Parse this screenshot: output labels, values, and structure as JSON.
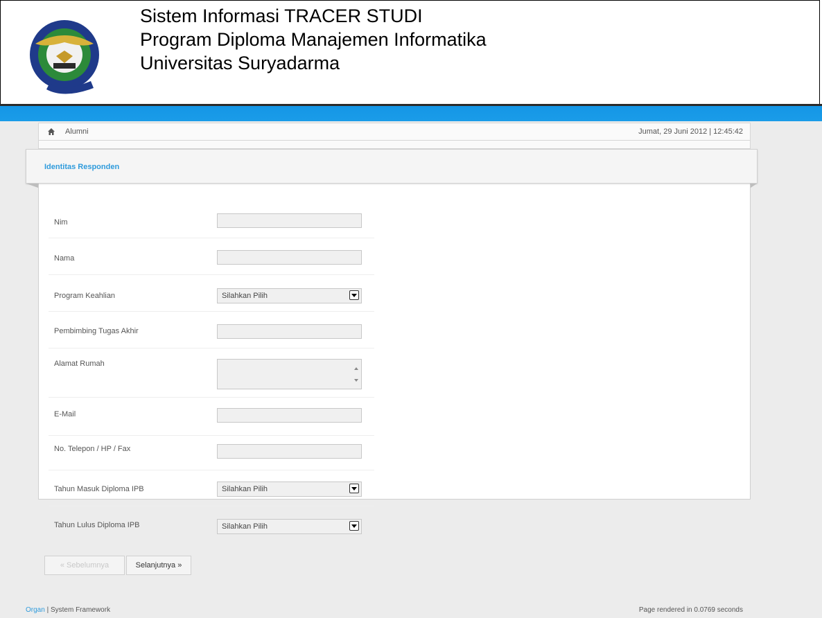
{
  "header": {
    "line1": "Sistem Informasi TRACER STUDI",
    "line2": "Program Diploma Manajemen Informatika",
    "line3": "Universitas Suryadarma"
  },
  "breadcrumb": {
    "home_icon": "home-icon",
    "current": "Alumni",
    "datetime": "Jumat, 29 Juni 2012 | 12:45:42"
  },
  "panel": {
    "title": "Identitas Responden"
  },
  "form": {
    "fields": [
      {
        "label": "Nim"
      },
      {
        "label": "Nama"
      },
      {
        "label": "Program Keahlian",
        "selected": "Silahkan Pilih"
      },
      {
        "label": "Pembimbing Tugas Akhir"
      },
      {
        "label": "Alamat Rumah"
      },
      {
        "label": "E-Mail"
      },
      {
        "label": "No. Telepon / HP / Fax"
      },
      {
        "label": "Tahun Masuk Diploma IPB",
        "selected": "Silahkan Pilih"
      },
      {
        "label": "Tahun Lulus Diploma IPB",
        "selected": "Silahkan Pilih"
      }
    ],
    "prev_label": "« Sebelumnya",
    "next_label": "Selanjutnya »"
  },
  "footer": {
    "link": "Organ",
    "text": " | System Framework",
    "rendered": "Page rendered in 0.0769 seconds"
  },
  "colors": {
    "accent": "#1a9ce8",
    "link": "#2f9bdc"
  }
}
